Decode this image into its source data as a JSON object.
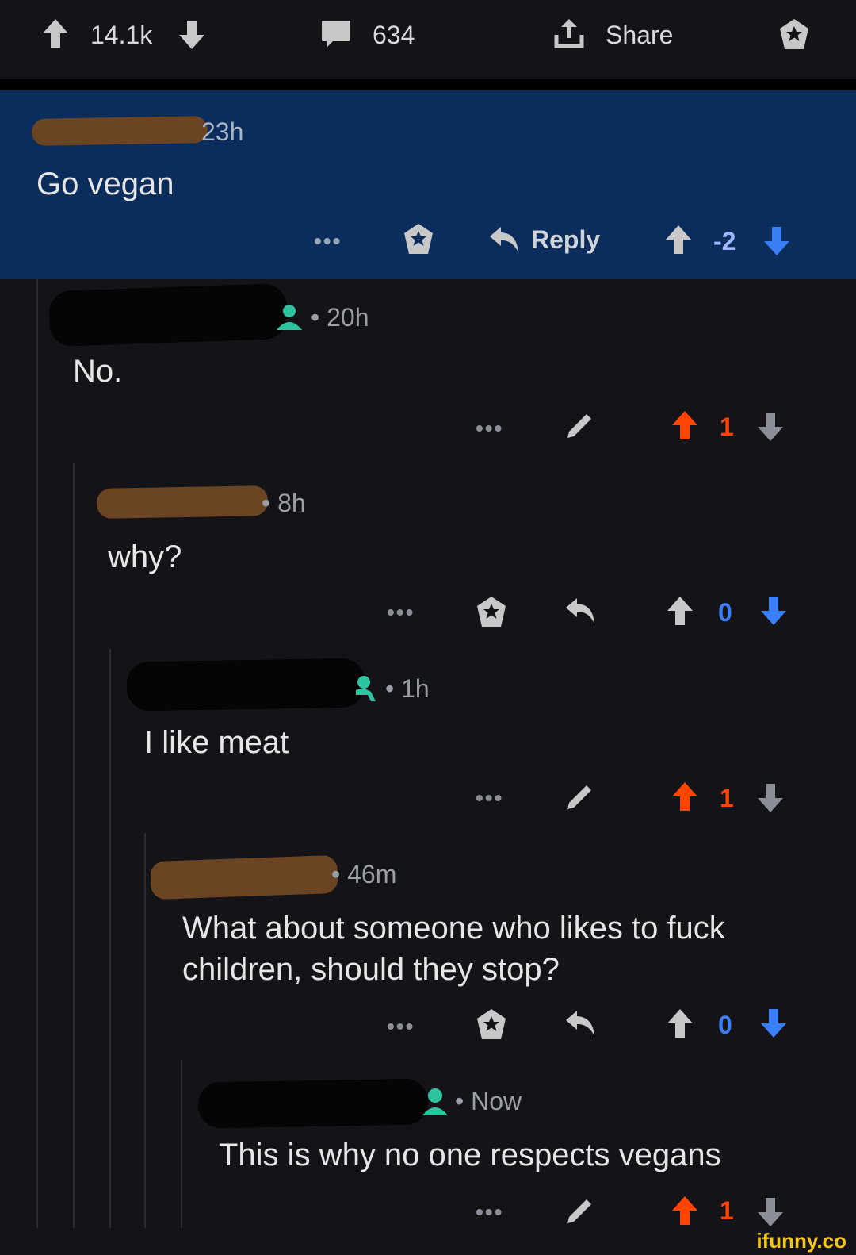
{
  "post_bar": {
    "upvotes": "14.1k",
    "comments": "634",
    "share_label": "Share"
  },
  "comments": [
    {
      "time": "23h",
      "body": "Go vegan",
      "reply_label": "Reply",
      "score": "-2"
    },
    {
      "time": "• 20h",
      "body": "No.",
      "score": "1"
    },
    {
      "time": "• 8h",
      "body": "why?",
      "score": "0"
    },
    {
      "time": "• 1h",
      "body": "I like meat",
      "score": "1"
    },
    {
      "time": "• 46m",
      "body_line1": "What about someone who likes to fuck",
      "body_line2": "children, should they stop?",
      "score": "0"
    },
    {
      "time": "• Now",
      "body": "This is why no one respects vegans",
      "score": "1"
    }
  ],
  "watermark": "ifunny.co",
  "colors": {
    "upvote_active": "#ff4500",
    "downvote_active": "#3a7ff6",
    "highlight_bg": "#0a2d5c",
    "avatar_green": "#2ec4a0"
  },
  "icons": [
    "arrow-up-icon",
    "arrow-down-icon",
    "comment-icon",
    "share-icon",
    "award-icon",
    "more-dots-icon",
    "reply-icon",
    "edit-pencil-icon",
    "user-avatar-icon"
  ]
}
